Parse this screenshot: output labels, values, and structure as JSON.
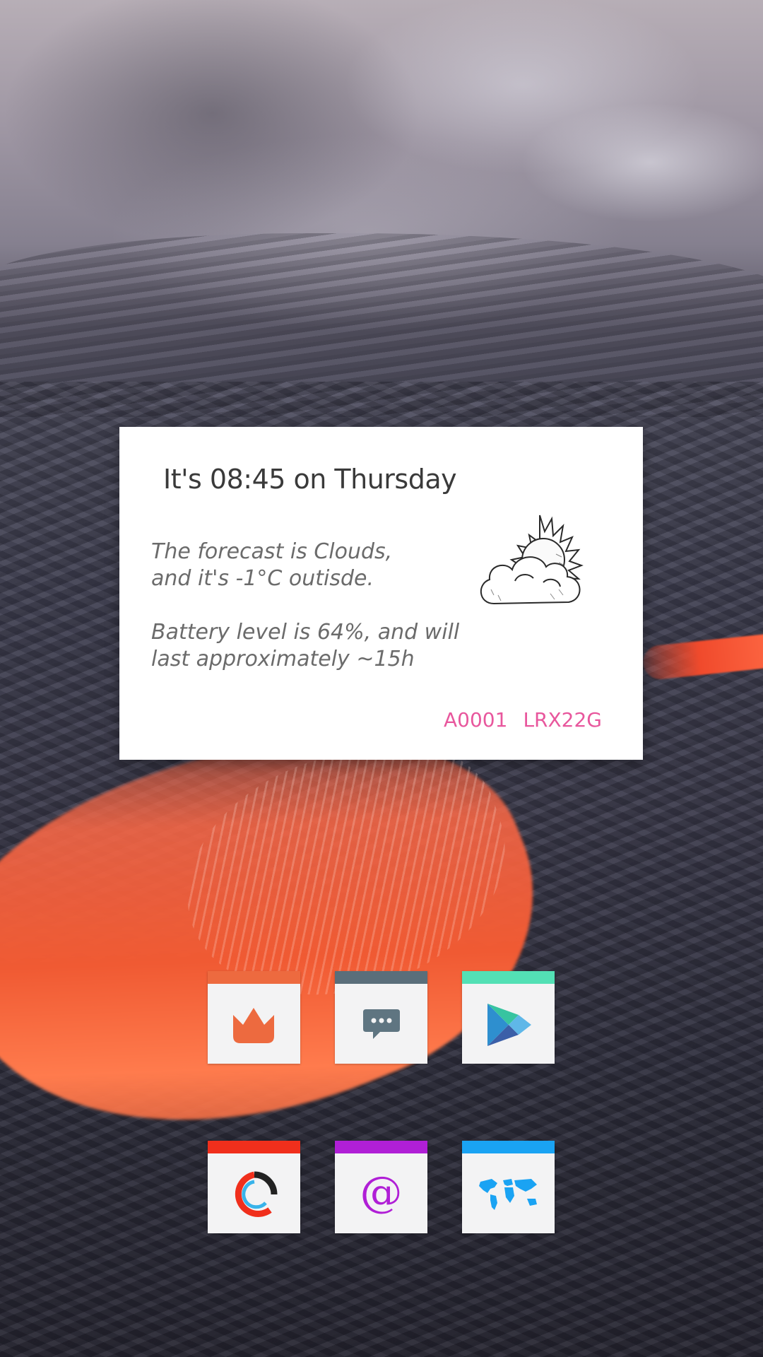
{
  "widget": {
    "time_line": "It's 08:45 on Thursday",
    "forecast_lines": [
      "The forecast is Clouds,",
      "and it's -1°C outisde."
    ],
    "battery_lines": [
      "Battery level is 64%, and will",
      "last approximately ~15h"
    ],
    "weather_icon": "partly-cloudy-icon",
    "build_id": "A0001",
    "build_number": "LRX22G",
    "accent_color": "#e8579d"
  },
  "apps": [
    {
      "name": "app-crown",
      "icon": "crown-icon",
      "bar_color": "#ed6a3f",
      "icon_color": "#ed6a3f"
    },
    {
      "name": "app-messaging",
      "icon": "chat-bubble-icon",
      "bar_color": "#5a6e7a",
      "icon_color": "#5f7581"
    },
    {
      "name": "app-play-store",
      "icon": "play-store-icon",
      "bar_color": "#53e0b5",
      "icon_color": "#3bb5d8"
    },
    {
      "name": "app-ring",
      "icon": "ring-icon",
      "bar_color": "#f02f1c",
      "icon_color": "#f02f1c"
    },
    {
      "name": "app-email",
      "icon": "at-sign-icon",
      "bar_color": "#b01fd6",
      "icon_color": "#b01fd6",
      "glyph": "@"
    },
    {
      "name": "app-world-map",
      "icon": "world-map-icon",
      "bar_color": "#1aa3f3",
      "icon_color": "#1aa3f3"
    }
  ]
}
